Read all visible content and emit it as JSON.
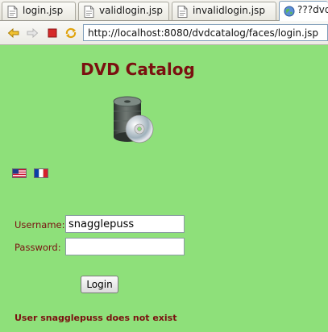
{
  "tabs": [
    {
      "label": "login.jsp",
      "icon": "jsp-file-icon",
      "active": false
    },
    {
      "label": "validlogin.jsp",
      "icon": "jsp-file-icon",
      "active": false
    },
    {
      "label": "invalidlogin.jsp",
      "icon": "jsp-file-icon",
      "active": false
    },
    {
      "label": "???dvd",
      "icon": "globe-icon",
      "active": true
    }
  ],
  "toolbar": {
    "back_icon": "back-arrow-icon",
    "forward_icon": "forward-arrow-icon",
    "stop_icon": "stop-icon",
    "refresh_icon": "refresh-icon",
    "url": "http://localhost:8080/dvdcatalog/faces/login.jsp"
  },
  "page": {
    "title": "DVD Catalog",
    "image_icon": "dvd-disc-stack-icon",
    "flags": [
      {
        "name": "us-flag-icon"
      },
      {
        "name": "france-flag-icon"
      }
    ],
    "form": {
      "username_label": "Username:",
      "username_value": "snagglepuss",
      "password_label": "Password:",
      "password_value": "",
      "login_label": "Login"
    },
    "error": "User snagglepuss does not exist"
  },
  "colors": {
    "page_background": "#8ee07a",
    "accent_text": "#7a1010",
    "url_border": "#7f9db9"
  }
}
